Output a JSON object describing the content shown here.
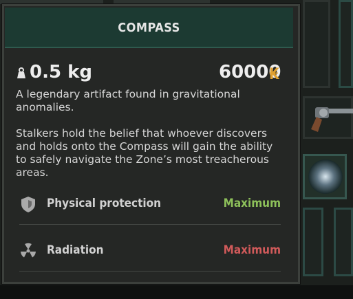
{
  "item": {
    "title": "COMPASS",
    "weight": "0.5 kg",
    "price": "60000",
    "currency_symbol": "₭",
    "description_1": "A legendary artifact found in gravitational anomalies.",
    "description_2": "Stalkers hold the belief that whoever discovers and holds onto the Compass will gain the ability to safely navigate the Zone’s most treacherous areas.",
    "stats": [
      {
        "label": "Physical protection",
        "value": "Maximum",
        "value_color": "#8dc05a",
        "icon": "shield-icon"
      },
      {
        "label": "Radiation",
        "value": "Maximum",
        "value_color": "#d05a5a",
        "icon": "radiation-icon"
      }
    ]
  },
  "colors": {
    "header_bg": "#1c3a32",
    "panel_bg": "#252725",
    "currency": "#e0a030"
  }
}
